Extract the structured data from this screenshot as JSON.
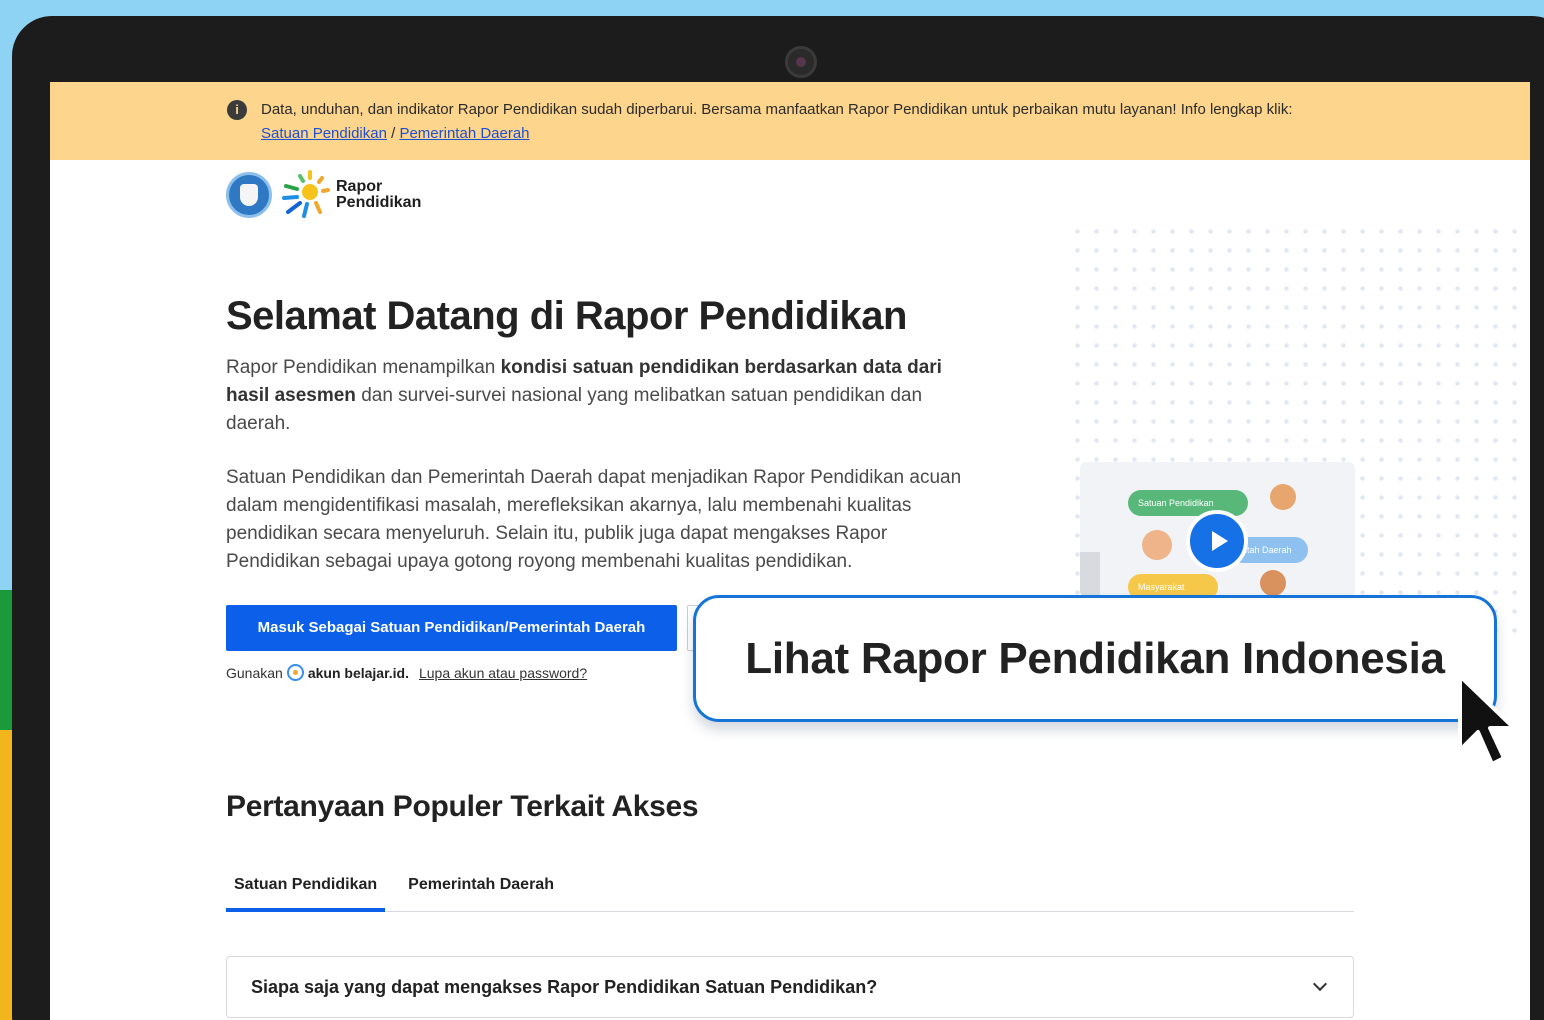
{
  "banner": {
    "text": "Data, unduhan, dan indikator Rapor Pendidikan sudah diperbarui. Bersama manfaatkan Rapor Pendidikan untuk perbaikan mutu layanan! Info lengkap klik: ",
    "link_satuan": "Satuan Pendidikan",
    "separator": " / ",
    "link_pemda": "Pemerintah Daerah",
    "icon": "info-icon"
  },
  "logo": {
    "line1": "Rapor",
    "line2": "Pendidikan"
  },
  "hero": {
    "title": "Selamat Datang di Rapor Pendidikan",
    "p1_a": "Rapor Pendidikan menampilkan ",
    "p1_bold": "kondisi satuan pendidikan berdasarkan data dari hasil asesmen",
    "p1_b": " dan survei-survei nasional yang melibatkan satuan pendidikan dan daerah.",
    "p2": "Satuan Pendidikan dan Pemerintah Daerah dapat menjadikan Rapor Pendidikan acuan dalam mengidentifikasi masalah, merefleksikan akarnya, lalu membenahi kualitas pendidikan secara menyeluruh. Selain itu, publik juga dapat mengakses Rapor Pendidikan sebagai upaya gotong royong membenahi kualitas pendidikan."
  },
  "video": {
    "pill_green": "Satuan Pendidikan",
    "pill_blue": "intah Daerah",
    "pill_yellow": "Masyarakat"
  },
  "login": {
    "button_label": "Masuk Sebagai Satuan Pendidikan/Pemerintah Daerah",
    "hint_prefix": "Gunakan",
    "hint_account": "akun belajar.id.",
    "forgot": "Lupa akun atau password?"
  },
  "callout": {
    "label": "Lihat Rapor Pendidikan Indonesia"
  },
  "faq": {
    "title": "Pertanyaan Populer Terkait Akses",
    "tabs": [
      {
        "label": "Satuan Pendidikan",
        "active": true
      },
      {
        "label": "Pemerintah Daerah",
        "active": false
      }
    ],
    "questions": [
      "Siapa saja yang dapat mengakses Rapor Pendidikan Satuan Pendidikan?"
    ]
  },
  "colors": {
    "banner_bg": "#fdd58c",
    "primary": "#0b5fe8",
    "callout_border": "#1674d9",
    "sky": "#8fd3f4"
  }
}
